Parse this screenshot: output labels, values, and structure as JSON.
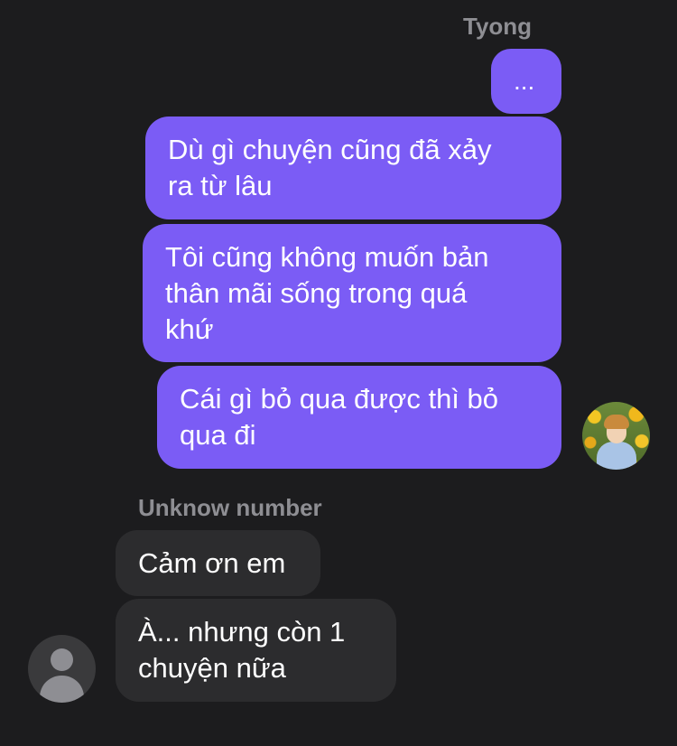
{
  "conversation": {
    "outgoing_sender": "Tyong",
    "incoming_sender": "Unknow number",
    "outgoing_messages": [
      "...",
      "Dù gì chuyện cũng đã xảy\nra từ lâu",
      "Tôi cũng không muốn bản\nthân mãi sống trong quá\nkhứ",
      "Cái gì bỏ qua được thì bỏ\nqua đi"
    ],
    "incoming_messages": [
      "Cảm ơn em",
      "À... nhưng còn 1\nchuyện nữa"
    ]
  },
  "colors": {
    "background": "#1c1c1e",
    "outgoing_bubble": "#7b5cf5",
    "incoming_bubble": "#2c2c2e",
    "sender_name": "#8e8e93",
    "text": "#ffffff"
  },
  "icons": {
    "outgoing_avatar": "profile-photo-icon",
    "incoming_avatar": "default-person-icon"
  }
}
